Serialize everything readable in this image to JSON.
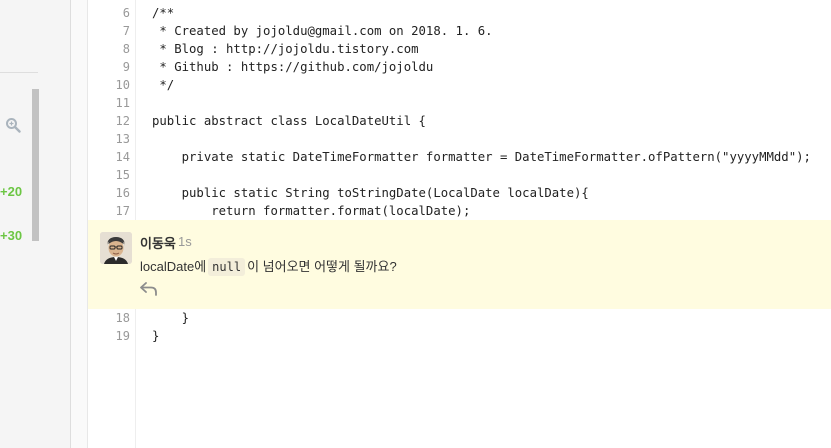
{
  "sidebar": {
    "diff_counts": [
      "+20",
      "+30"
    ],
    "search_icon": "search-icon"
  },
  "code": {
    "lines_before": [
      {
        "num": "6",
        "text": "/**"
      },
      {
        "num": "7",
        "text": " * Created by jojoldu@gmail.com on 2018. 1. 6."
      },
      {
        "num": "8",
        "text": " * Blog : http://jojoldu.tistory.com"
      },
      {
        "num": "9",
        "text": " * Github : https://github.com/jojoldu"
      },
      {
        "num": "10",
        "text": " */"
      },
      {
        "num": "11",
        "text": ""
      },
      {
        "num": "12",
        "text": "public abstract class LocalDateUtil {"
      },
      {
        "num": "13",
        "text": ""
      },
      {
        "num": "14",
        "text": "    private static DateTimeFormatter formatter = DateTimeFormatter.ofPattern(\"yyyyMMdd\");"
      },
      {
        "num": "15",
        "text": ""
      },
      {
        "num": "16",
        "text": "    public static String toStringDate(LocalDate localDate){"
      },
      {
        "num": "17",
        "text": "        return formatter.format(localDate);"
      }
    ],
    "lines_after": [
      {
        "num": "18",
        "text": "    }"
      },
      {
        "num": "19",
        "text": "}"
      }
    ]
  },
  "comment": {
    "author": "이동욱",
    "time": "1s",
    "body_before": "localDate에",
    "body_code": "null",
    "body_after": "이 넘어오면 어떻게 될까요?",
    "reply_icon": "reply-icon",
    "highlight_color": "#fffce0"
  }
}
